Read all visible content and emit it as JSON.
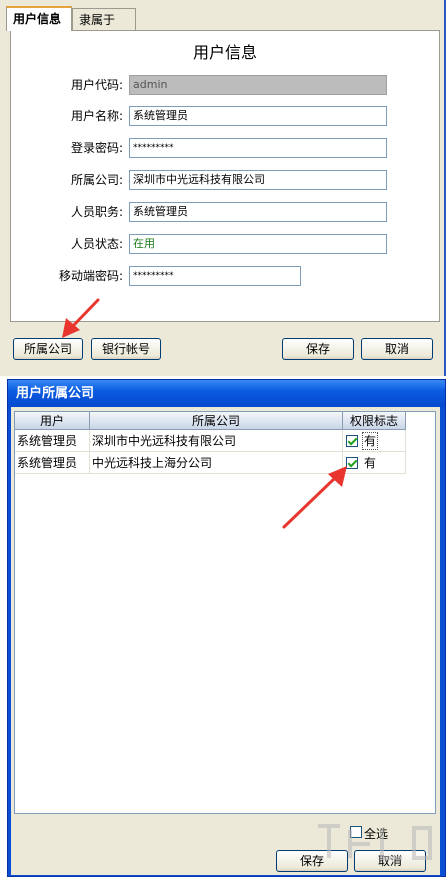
{
  "top_window": {
    "tabs": [
      {
        "label": "用户信息",
        "active": true
      },
      {
        "label": "隶属于",
        "active": false
      }
    ],
    "form_title": "用户信息",
    "fields": [
      {
        "label": "用户代码:",
        "value": "admin",
        "state": "disabled"
      },
      {
        "label": "用户名称:",
        "value": "系统管理员",
        "state": "normal"
      },
      {
        "label": "登录密码:",
        "value": "*********",
        "state": "password"
      },
      {
        "label": "所属公司:",
        "value": "深圳市中光远科技有限公司",
        "state": "normal"
      },
      {
        "label": "人员职务:",
        "value": "系统管理员",
        "state": "normal"
      },
      {
        "label": "人员状态:",
        "value": "在用",
        "state": "normal"
      },
      {
        "label": "移动端密码:",
        "value": "*********",
        "state": "password"
      }
    ],
    "buttons": {
      "company": "所属公司",
      "bank": "银行帐号",
      "save": "保存",
      "cancel": "取消"
    }
  },
  "dialog": {
    "title": "用户所属公司",
    "columns": [
      "用户",
      "所属公司",
      "权限标志"
    ],
    "rows": [
      {
        "user": "系统管理员",
        "company": "深圳市中光远科技有限公司",
        "flag_checked": true,
        "flag_label": "有"
      },
      {
        "user": "系统管理员",
        "company": "中光远科技上海分公司",
        "flag_checked": true,
        "flag_label": "有"
      }
    ],
    "select_all": {
      "label": "全选",
      "checked": false
    },
    "buttons": {
      "save": "保存",
      "cancel": "取消"
    }
  },
  "colors": {
    "title_bar": "#0a4ed4",
    "annotation_arrow": "#e8362f",
    "checkmark": "#21a121",
    "status_text": "#1a7a1a"
  }
}
